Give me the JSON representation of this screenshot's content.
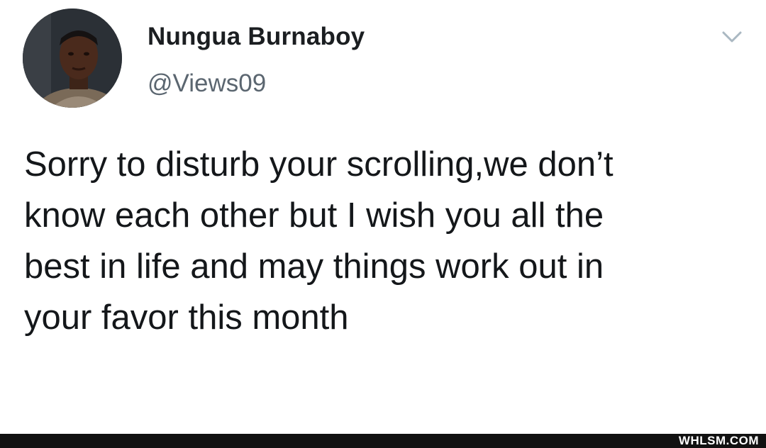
{
  "tweet": {
    "display_name": "Nungua Burnaboy",
    "handle": "@Views09",
    "text": "Sorry to disturb your scrolling,we don’t\nknow each other but I wish you all the\nbest in life and may things work out in\nyour favor this month",
    "menu_icon": "chevron-down-icon",
    "avatar": "profile-photo"
  },
  "footer": {
    "watermark": "WHLSM.COM"
  },
  "colors": {
    "background": "#ffffff",
    "text": "#14171a",
    "handle": "#5b6670",
    "chevron": "#aab8c2",
    "footer_bar": "#111111"
  }
}
